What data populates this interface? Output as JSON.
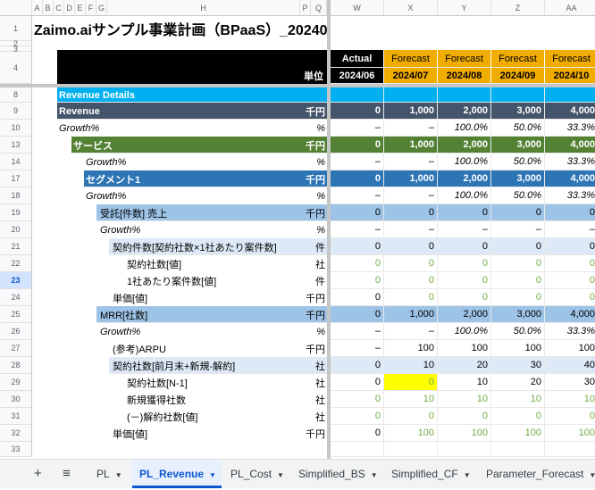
{
  "title": "Zaimo.aiサンプル事業計画（BPaaS）_20240",
  "col_letters": [
    "A",
    "B",
    "C",
    "D",
    "E",
    "F",
    "G",
    "H",
    "P",
    "Q",
    "W",
    "X",
    "Y",
    "Z",
    "AA"
  ],
  "unit_label": "単位",
  "header": {
    "types": [
      "Actual",
      "Forecast",
      "Forecast",
      "Forecast",
      "Forecast"
    ],
    "periods": [
      "2024/06",
      "2024/07",
      "2024/08",
      "2024/09",
      "2024/10"
    ]
  },
  "colors": {
    "actual_bg": "#000000",
    "forecast_bg": "#f1ac00",
    "revenue_details_bg": "#00b0f0",
    "revenue_bg": "#44546a",
    "service_bg": "#548235",
    "segment_bg": "#2e75b6",
    "subtotal_bg": "#9dc3e6",
    "sub_bg": "#dde9f6",
    "green_text": "#70ad47",
    "highlight": "#ffff00"
  },
  "rows": [
    {
      "num": "8",
      "label": "Revenue Details",
      "unit": "",
      "vals": [
        "",
        "",
        "",
        "",
        ""
      ],
      "style": "rd"
    },
    {
      "num": "9",
      "label": "Revenue",
      "unit": "千円",
      "vals": [
        "0",
        "1,000",
        "2,000",
        "3,000",
        "4,000"
      ],
      "style": "rev"
    },
    {
      "num": "10",
      "label": "Growth%",
      "unit": "%",
      "vals": [
        "–",
        "–",
        "100.0%",
        "50.0%",
        "33.3%"
      ],
      "style": "gr"
    },
    {
      "num": "13",
      "label": "サービス",
      "unit": "千円",
      "vals": [
        "0",
        "1,000",
        "2,000",
        "3,000",
        "4,000"
      ],
      "style": "svc"
    },
    {
      "num": "14",
      "label": "Growth%",
      "unit": "%",
      "vals": [
        "–",
        "–",
        "100.0%",
        "50.0%",
        "33.3%"
      ],
      "style": "gr2"
    },
    {
      "num": "17",
      "label": "セグメント1",
      "unit": "千円",
      "vals": [
        "0",
        "1,000",
        "2,000",
        "3,000",
        "4,000"
      ],
      "style": "seg"
    },
    {
      "num": "18",
      "label": "Growth%",
      "unit": "%",
      "vals": [
        "–",
        "–",
        "100.0%",
        "50.0%",
        "33.3%"
      ],
      "style": "gr2"
    },
    {
      "num": "19",
      "label": "受託[件数] 売上",
      "unit": "千円",
      "vals": [
        "0",
        "0",
        "0",
        "0",
        "0"
      ],
      "style": "sub"
    },
    {
      "num": "20",
      "label": "Growth%",
      "unit": "%",
      "vals": [
        "–",
        "–",
        "–",
        "–",
        "–"
      ],
      "style": "gr3"
    },
    {
      "num": "21",
      "label": "契約件数[契約社数×1社あたり案件数]",
      "unit": "件",
      "vals": [
        "0",
        "0",
        "0",
        "0",
        "0"
      ],
      "style": "sub2"
    },
    {
      "num": "22",
      "label": "契約社数[値]",
      "unit": "社",
      "vals": [
        "0",
        "0",
        "0",
        "0",
        "0"
      ],
      "style": "l5"
    },
    {
      "num": "23",
      "label": "1社あたり案件数[値]",
      "unit": "件",
      "vals": [
        "0",
        "0",
        "0",
        "0",
        "0"
      ],
      "style": "l5",
      "sel": true
    },
    {
      "num": "24",
      "label": "単価[値]",
      "unit": "千円",
      "vals": [
        "0",
        "0",
        "0",
        "0",
        "0"
      ],
      "style": "l4g"
    },
    {
      "num": "25",
      "label": "MRR[社数]",
      "unit": "千円",
      "vals": [
        "0",
        "1,000",
        "2,000",
        "3,000",
        "4,000"
      ],
      "style": "sub"
    },
    {
      "num": "26",
      "label": "Growth%",
      "unit": "%",
      "vals": [
        "–",
        "–",
        "100.0%",
        "50.0%",
        "33.3%"
      ],
      "style": "gr3"
    },
    {
      "num": "27",
      "label": "(参考)ARPU",
      "unit": "千円",
      "vals": [
        "–",
        "100",
        "100",
        "100",
        "100"
      ],
      "style": "l4"
    },
    {
      "num": "28",
      "label": "契約社数[前月末+新規-解約]",
      "unit": "社",
      "vals": [
        "0",
        "10",
        "20",
        "30",
        "40"
      ],
      "style": "sub2"
    },
    {
      "num": "29",
      "label": "契約社数[N-1]",
      "unit": "社",
      "vals": [
        "0",
        "0",
        "10",
        "20",
        "30"
      ],
      "style": "l5n"
    },
    {
      "num": "30",
      "label": "新規獲得社数",
      "unit": "社",
      "vals": [
        "0",
        "10",
        "10",
        "10",
        "10"
      ],
      "style": "l5"
    },
    {
      "num": "31",
      "label": "(－)解約社数[値]",
      "unit": "社",
      "vals": [
        "0",
        "0",
        "0",
        "0",
        "0"
      ],
      "style": "l5"
    },
    {
      "num": "32",
      "label": "単価[値]",
      "unit": "千円",
      "vals": [
        "0",
        "100",
        "100",
        "100",
        "100"
      ],
      "style": "l4g"
    },
    {
      "num": "33",
      "label": "",
      "unit": "",
      "vals": [
        "",
        "",
        "",
        "",
        ""
      ],
      "style": "empty"
    }
  ],
  "tabs": {
    "add_label": "+",
    "menu_label": "≡",
    "sheets": [
      {
        "label": "PL",
        "active": false
      },
      {
        "label": "PL_Revenue",
        "active": true
      },
      {
        "label": "PL_Cost",
        "active": false
      },
      {
        "label": "Simplified_BS",
        "active": false
      },
      {
        "label": "Simplified_CF",
        "active": false
      },
      {
        "label": "Parameter_Forecast",
        "active": false
      }
    ]
  }
}
